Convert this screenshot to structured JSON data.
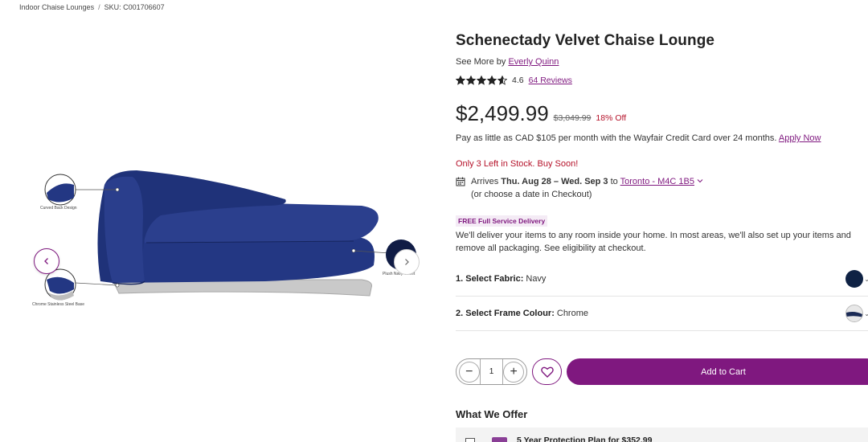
{
  "breadcrumb": {
    "category": "Indoor Chaise Lounges",
    "separator": "/",
    "sku": "SKU: C001706607"
  },
  "gallery": {
    "callouts": {
      "curved_back": "Curved Back Design",
      "steel_base": "Chrome Stainless Steel Base",
      "velvet": "Plush Navy Velvet"
    }
  },
  "product": {
    "title": "Schenectady Velvet Chaise Lounge",
    "see_more_prefix": "See More by",
    "brand": "Everly Quinn",
    "rating": "4.6",
    "rating_fraction": 0.92,
    "reviews": "64 Reviews",
    "price": "$2,499.99",
    "was_price": "$3,049.99",
    "discount": "18% Off",
    "finance_text": "Pay as little as CAD $105 per month with the Wayfair Credit Card over 24 months.",
    "finance_link": "Apply Now",
    "stock": "Only 3 Left in Stock. Buy Soon!",
    "arrives_prefix": "Arrives",
    "arrives_dates": "Thu. Aug 28 – Wed. Sep 3",
    "arrives_to": "to",
    "location": "Toronto - M4C 1B5",
    "checkout_note": "(or choose a date in Checkout)",
    "delivery_badge": "FREE Full Service Delivery",
    "delivery_text": "We'll deliver your items to any room inside your home. In most areas, we'll also set up your items and remove all packaging. See eligibility at checkout."
  },
  "options": [
    {
      "label": "1. Select Fabric:",
      "value": "Navy",
      "swatch_color": "#0f2244"
    },
    {
      "label": "2. Select Frame Colour:",
      "value": "Chrome",
      "swatch_color": "#1a2a55"
    }
  ],
  "cart": {
    "quantity": "1",
    "minus": "−",
    "plus": "+",
    "add_to_cart": "Add to Cart"
  },
  "offer": {
    "heading": "What We Offer",
    "protection": "5 Year Protection Plan for $352.99"
  },
  "colors": {
    "brand_purple": "#7f187f",
    "sale_red": "#b5122a",
    "sofa_navy": "#1d2f73"
  }
}
